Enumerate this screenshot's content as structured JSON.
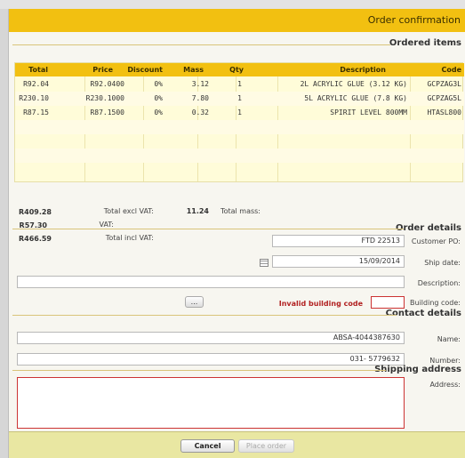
{
  "window": {
    "title": "Order confirmation"
  },
  "ordered_items": {
    "heading": "Ordered items",
    "columns": [
      "Code",
      "Description",
      "Qty",
      "Mass",
      "Discount",
      "Price",
      "Total"
    ],
    "rows": [
      {
        "code": "GCPZAG3L",
        "description": "2L ACRYLIC GLUE (3.12 KG)",
        "qty": "1",
        "mass": "3.12",
        "discount": "0%",
        "price": "R92.0400",
        "total": "R92.04"
      },
      {
        "code": "GCPZAG5L",
        "description": "5L ACRYLIC GLUE (7.8 KG)",
        "qty": "1",
        "mass": "7.80",
        "discount": "0%",
        "price": "R230.1000",
        "total": "R230.10"
      },
      {
        "code": "HTASL800",
        "description": "SPIRIT LEVEL 800MM",
        "qty": "1",
        "mass": "0.32",
        "discount": "0%",
        "price": "R87.1500",
        "total": "R87.15"
      }
    ]
  },
  "summary": {
    "total_mass_label": "Total mass:",
    "total_mass_value": "11.24",
    "excl_vat_label": "Total excl VAT:",
    "excl_vat_value": "R409.28",
    "vat_label": "VAT:",
    "vat_value": "R57.30",
    "incl_vat_label": "Total incl VAT:",
    "incl_vat_value": "R466.59"
  },
  "order_details": {
    "heading": "Order details",
    "customer_po_label": "Customer PO:",
    "customer_po_value": "FTD 22513",
    "ship_date_label": "Ship date:",
    "ship_date_value": "15/09/2014",
    "description_label": "Description:",
    "description_value": "",
    "building_code_label": "Building code:",
    "building_code_value": "",
    "building_code_error": "Invalid building code",
    "lookup_label": "..."
  },
  "contact_details": {
    "heading": "Contact details",
    "name_label": "Name:",
    "name_value": "ABSA-4044387630",
    "number_label": "Number:",
    "number_value": "031- 5779632"
  },
  "shipping_address": {
    "heading": "Shipping address",
    "address_label": "Address:",
    "address_value": ""
  },
  "footer": {
    "place_order_label": "Place order",
    "cancel_label": "Cancel"
  },
  "colors": {
    "accent": "#f2c011",
    "grid_background": "#fffcd9",
    "error": "#cc3333",
    "footer": "#e9e7a2"
  }
}
